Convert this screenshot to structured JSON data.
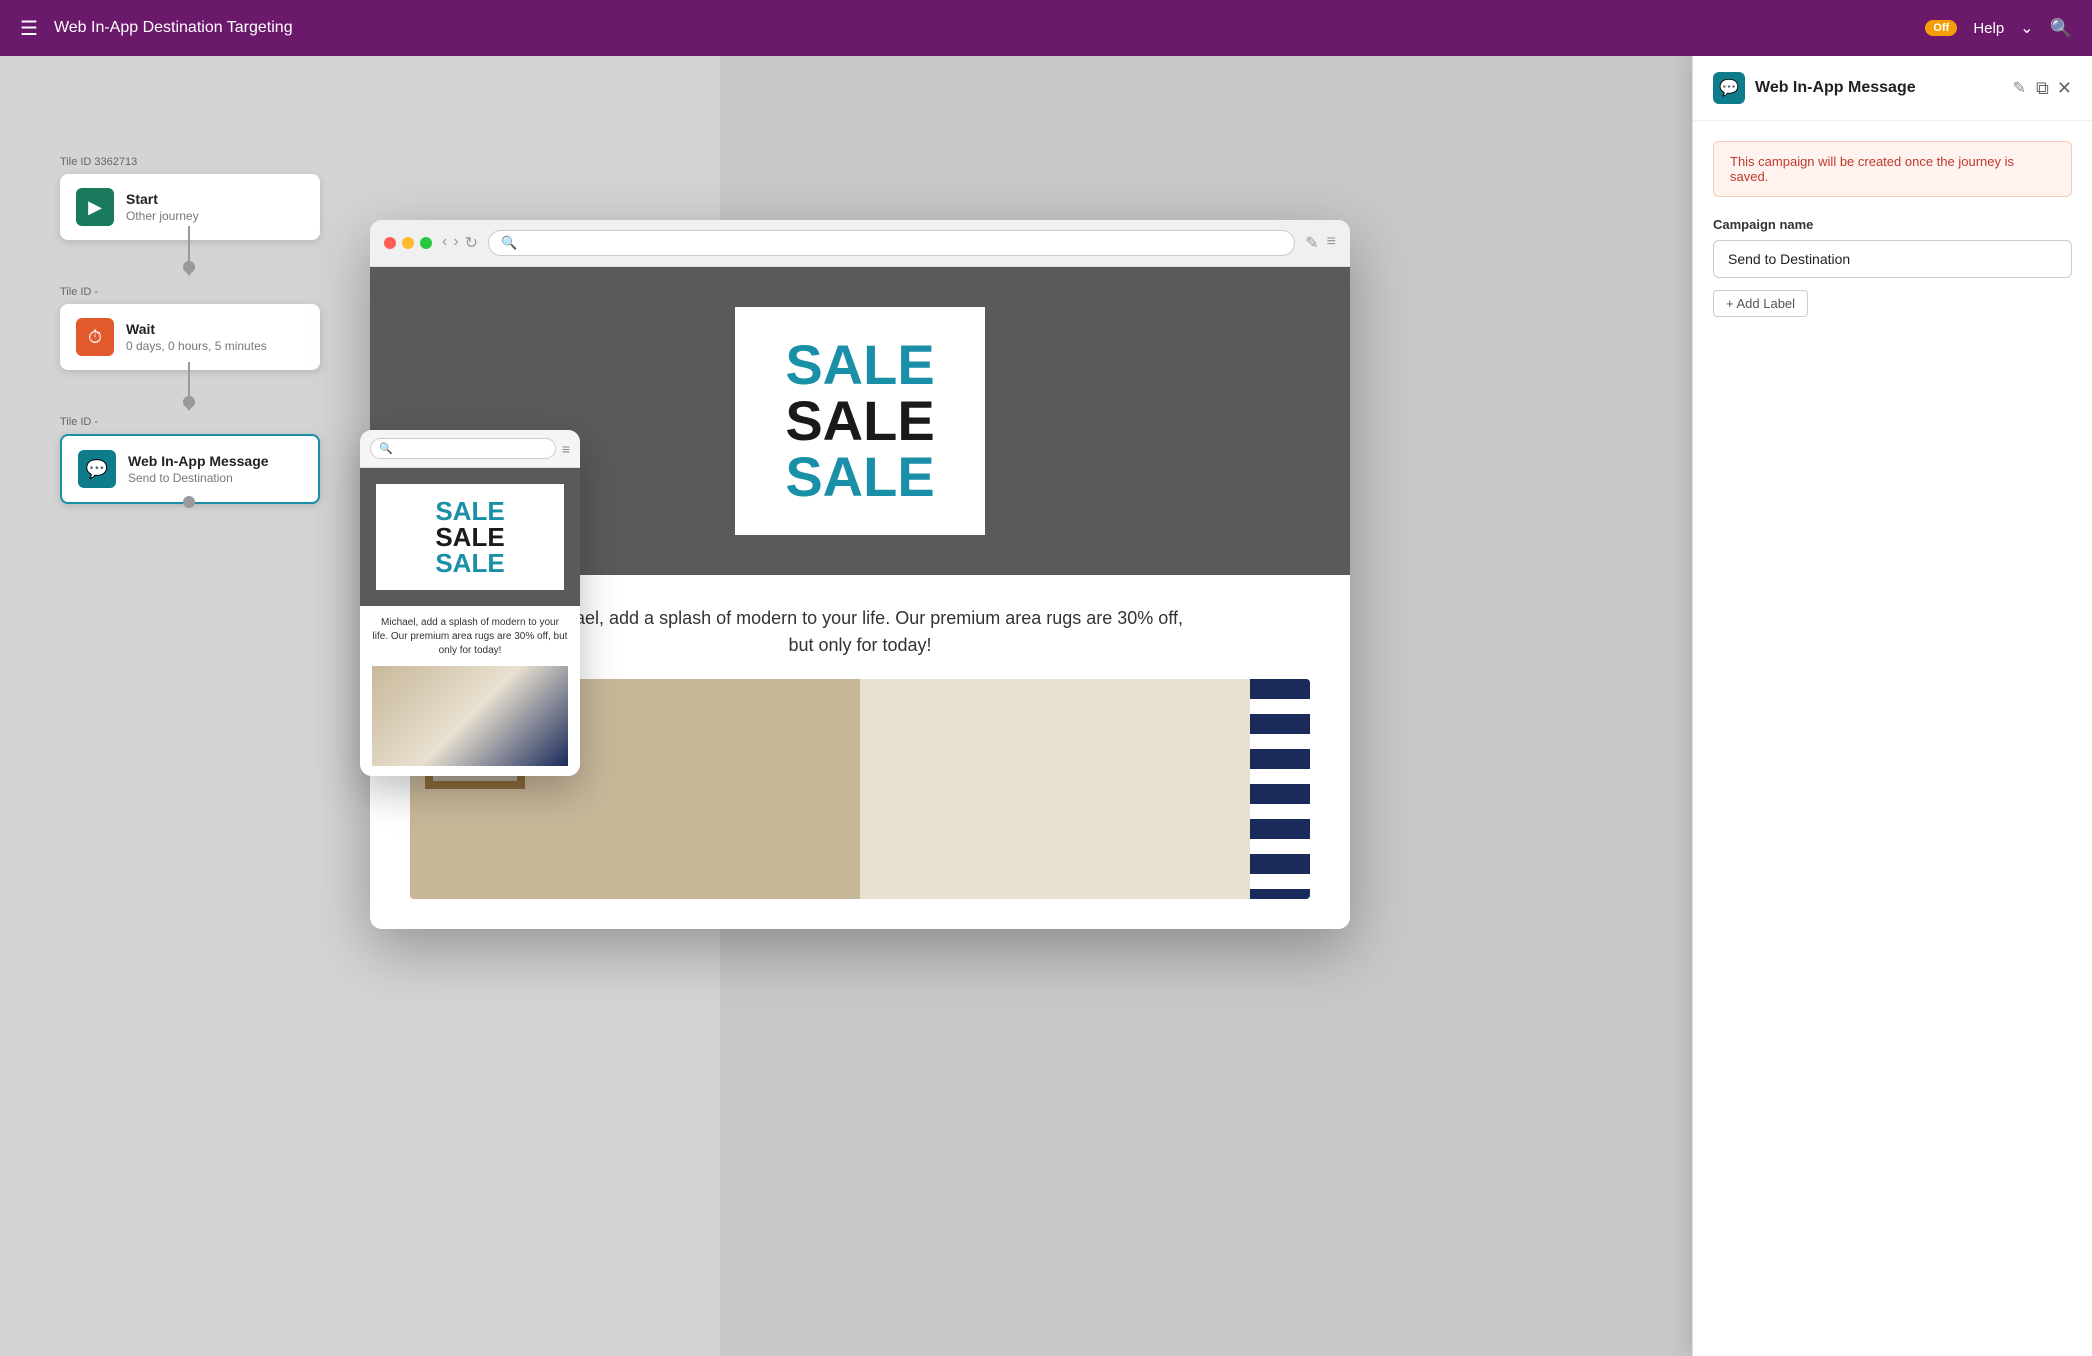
{
  "nav": {
    "title": "Web In-App Destination Targeting",
    "badge": "Off",
    "help_label": "Help",
    "hamburger_icon": "☰",
    "search_icon": "🔍",
    "chevron_icon": "⌄"
  },
  "journey": {
    "nodes": [
      {
        "tile_id": "Tile ID 3362713",
        "type": "start",
        "icon": "▶",
        "icon_color": "green",
        "primary": "Start",
        "secondary": "Other journey"
      },
      {
        "tile_id": "Tile ID -",
        "type": "wait",
        "icon": "⏱",
        "icon_color": "orange",
        "primary": "Wait",
        "secondary": "0 days, 0 hours, 5 minutes"
      },
      {
        "tile_id": "Tile ID -",
        "type": "message",
        "icon": "💬",
        "icon_color": "teal",
        "primary": "Web In-App Message",
        "secondary": "Send to Destination"
      }
    ]
  },
  "panel": {
    "icon": "💬",
    "title": "Web In-App Message",
    "edit_icon": "✎",
    "copy_icon": "⧉",
    "close_icon": "✕",
    "alert_text": "This campaign will be created once the journey is saved.",
    "form": {
      "campaign_name_label": "Campaign name",
      "campaign_name_value": "Send to Destination",
      "add_label_button": "+ Add Label"
    }
  },
  "browser": {
    "url": "",
    "sale_lines": [
      "SALE",
      "SALE",
      "SALE"
    ],
    "promo_text": "Michael, add a splash of modern to your life. Our premium area rugs are 30% off,",
    "promo_text2": "but only for today!"
  },
  "mobile": {
    "sale_lines": [
      "SALE",
      "SALE",
      "SALE"
    ],
    "promo_text": "Michael, add a splash of modern to your life. Our premium area rugs are 30% off, but only for today!"
  }
}
